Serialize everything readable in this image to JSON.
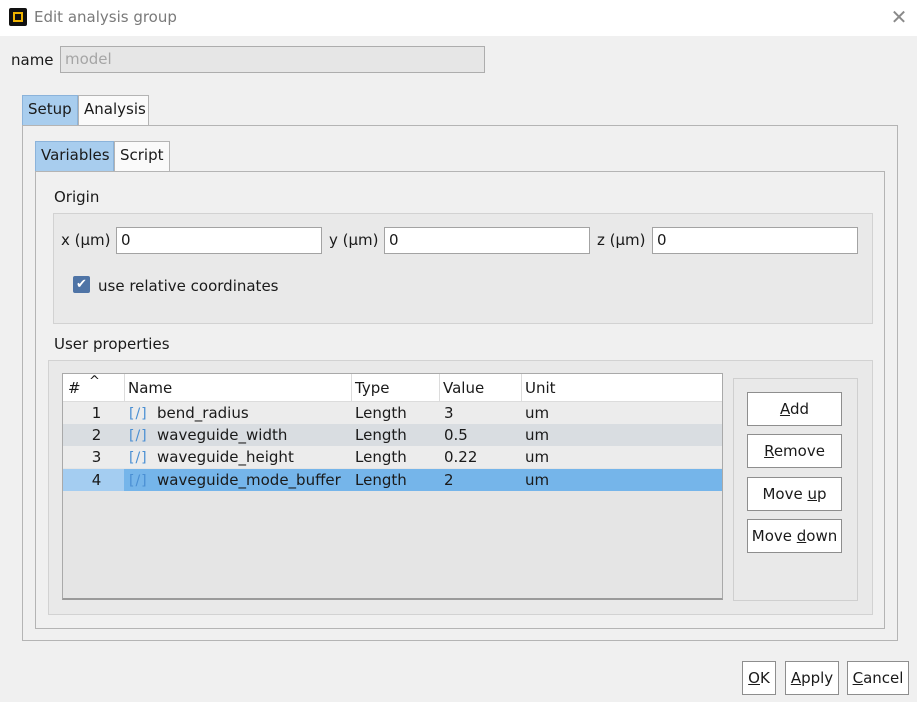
{
  "window": {
    "title": "Edit analysis group",
    "close_glyph": "✕"
  },
  "name": {
    "label": "name",
    "value": "model"
  },
  "tabs": {
    "setup": "Setup",
    "analysis": "Analysis"
  },
  "subtabs": {
    "variables": "Variables",
    "script": "Script"
  },
  "origin": {
    "heading": "Origin",
    "x": {
      "label": "x (µm)",
      "value": "0"
    },
    "y": {
      "label": "y (µm)",
      "value": "0"
    },
    "z": {
      "label": "z (µm)",
      "value": "0"
    },
    "relative_label": "use relative coordinates",
    "relative_checked": true
  },
  "user_properties": {
    "heading": "User properties",
    "columns": {
      "index": "#",
      "sort": "^",
      "name": "Name",
      "type": "Type",
      "value": "Value",
      "unit": "Unit"
    },
    "var_icon": "[/]",
    "rows": [
      {
        "index": "1",
        "name": "bend_radius",
        "type": "Length",
        "value": "3",
        "unit": "um"
      },
      {
        "index": "2",
        "name": "waveguide_width",
        "type": "Length",
        "value": "0.5",
        "unit": "um"
      },
      {
        "index": "3",
        "name": "waveguide_height",
        "type": "Length",
        "value": "0.22",
        "unit": "um"
      },
      {
        "index": "4",
        "name": "waveguide_mode_buffer",
        "type": "Length",
        "value": "2",
        "unit": "um"
      }
    ],
    "selected_row": 4
  },
  "buttons": {
    "add": {
      "pre": "",
      "key": "A",
      "post": "dd"
    },
    "remove": {
      "pre": "",
      "key": "R",
      "post": "emove"
    },
    "move_up": {
      "pre": "Move ",
      "key": "u",
      "post": "p"
    },
    "move_down": {
      "pre": "Move ",
      "key": "d",
      "post": "own"
    },
    "ok": {
      "pre": "",
      "key": "O",
      "post": "K"
    },
    "apply": {
      "pre": "",
      "key": "A",
      "post": "pply"
    },
    "cancel": {
      "pre": "",
      "key": "C",
      "post": "ancel"
    }
  },
  "colors": {
    "selected_row": "#75b5ea",
    "active_tab": "#a8cdee",
    "checkbox": "#4f74a6"
  }
}
